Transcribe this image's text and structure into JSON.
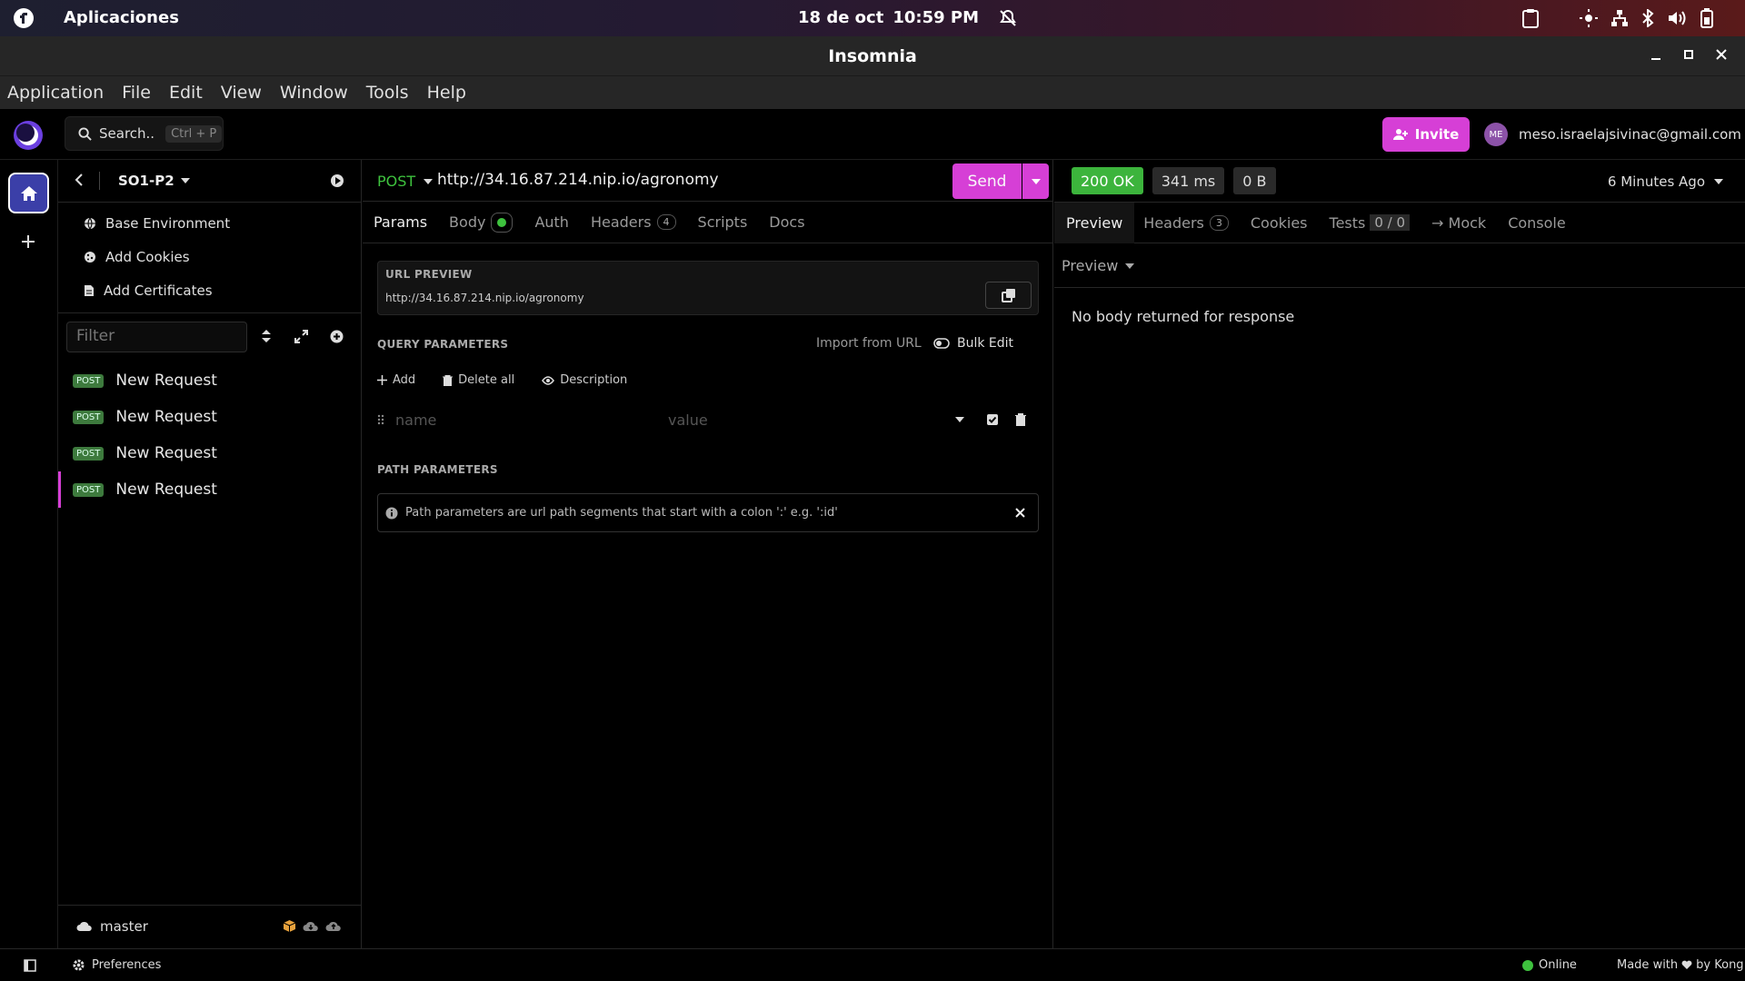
{
  "system": {
    "apps_label": "Aplicaciones",
    "date": "18 de oct",
    "time": "10:59 PM"
  },
  "window": {
    "title": "Insomnia"
  },
  "menu": [
    "Application",
    "File",
    "Edit",
    "View",
    "Window",
    "Tools",
    "Help"
  ],
  "header": {
    "search_label": "Search..",
    "search_shortcut": "Ctrl + P",
    "invite_label": "Invite",
    "avatar_initials": "ME",
    "user_email": "meso.israelajsivinac@gmail.com"
  },
  "sidebar": {
    "project": "SO1-P2",
    "env_items": [
      {
        "label": "Base Environment",
        "icon": "globe-icon"
      },
      {
        "label": "Add Cookies",
        "icon": "cookie-icon"
      },
      {
        "label": "Add Certificates",
        "icon": "file-icon"
      }
    ],
    "filter_placeholder": "Filter",
    "requests": [
      {
        "method": "POST",
        "name": "New Request"
      },
      {
        "method": "POST",
        "name": "New Request"
      },
      {
        "method": "POST",
        "name": "New Request"
      },
      {
        "method": "POST",
        "name": "New Request"
      }
    ],
    "branch": "master"
  },
  "request": {
    "method": "POST",
    "url": "http://34.16.87.214.nip.io/agronomy",
    "send_label": "Send",
    "tabs": {
      "params": "Params",
      "body": "Body",
      "auth": "Auth",
      "headers": "Headers",
      "headers_count": "4",
      "scripts": "Scripts",
      "docs": "Docs"
    },
    "url_preview_label": "URL PREVIEW",
    "url_preview": "http://34.16.87.214.nip.io/agronomy",
    "query_label": "QUERY PARAMETERS",
    "import_from_url": "Import from URL",
    "bulk_edit": "Bulk Edit",
    "add_label": "Add",
    "delete_all_label": "Delete all",
    "description_label": "Description",
    "name_placeholder": "name",
    "value_placeholder": "value",
    "path_label": "PATH PARAMETERS",
    "path_info": "Path parameters are url path segments that start with a colon ':' e.g. ':id'"
  },
  "response": {
    "status": "200 OK",
    "time": "341 ms",
    "size": "0 B",
    "ago": "6 Minutes Ago",
    "tabs": {
      "preview": "Preview",
      "headers": "Headers",
      "headers_count": "3",
      "cookies": "Cookies",
      "tests": "Tests",
      "tests_count": "0 / 0",
      "mock": "→ Mock",
      "console": "Console"
    },
    "preview_mode": "Preview",
    "empty_message": "No body returned for response"
  },
  "footer": {
    "preferences": "Preferences",
    "online": "Online",
    "made_with": "Made with",
    "by_kong": "by Kong"
  },
  "colors": {
    "accent": "#d63fd6",
    "status_ok": "#3cb43c",
    "post_badge": "#3d7a3d"
  }
}
